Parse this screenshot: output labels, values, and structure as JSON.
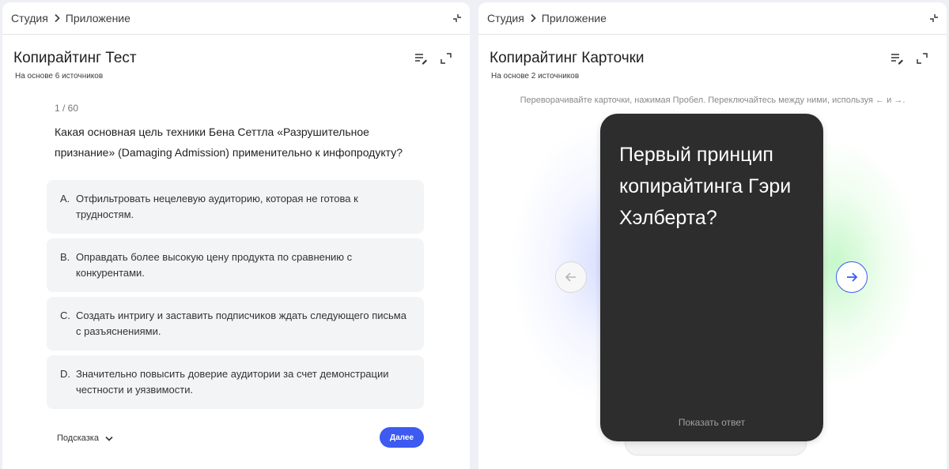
{
  "quiz_panel": {
    "breadcrumb": {
      "root": "Студия",
      "current": "Приложение"
    },
    "title": "Копирайтинг Тест",
    "sources": "На основе 6 источников",
    "counter": "1 / 60",
    "question": "Какая основная цель техники Бена Сеттла «Разрушительное признание» (Damaging Admission) применительно к инфопродукту?",
    "options": [
      {
        "letter": "A.",
        "text": "Отфильтровать нецелевую аудиторию, которая не готова к трудностям."
      },
      {
        "letter": "B.",
        "text": "Оправдать более высокую цену продукта по сравнению с конкурентами."
      },
      {
        "letter": "C.",
        "text": "Создать интригу и заставить подписчиков ждать следующего письма с разъяснениями."
      },
      {
        "letter": "D.",
        "text": "Значительно повысить доверие аудитории за счет демонстрации честности и уязвимости."
      }
    ],
    "hint_label": "Подсказка",
    "next_label": "Далее"
  },
  "cards_panel": {
    "breadcrumb": {
      "root": "Студия",
      "current": "Приложение"
    },
    "title": "Копирайтинг Карточки",
    "sources": "На основе 2 источников",
    "instructions": "Переворачивайте карточки, нажимая Пробел. Переключайтесь между ними, используя ← и →.",
    "card_front": "Первый принцип копирайтинга Гэри Хэлберта?",
    "reveal_label": "Показать ответ"
  },
  "icons": {
    "breadcrumb_separator": "chevron-right-icon",
    "collapse": "collapse-icon",
    "edit_list": "edit-list-icon",
    "expand": "expand-icon",
    "hint_toggle": "chevron-down-icon",
    "prev": "arrow-left-icon",
    "next": "arrow-right-icon"
  },
  "colors": {
    "accent": "#3d5af1",
    "card_background": "#2d2d2d",
    "option_background": "#f3f4f6",
    "page_background": "#eef0f6"
  }
}
